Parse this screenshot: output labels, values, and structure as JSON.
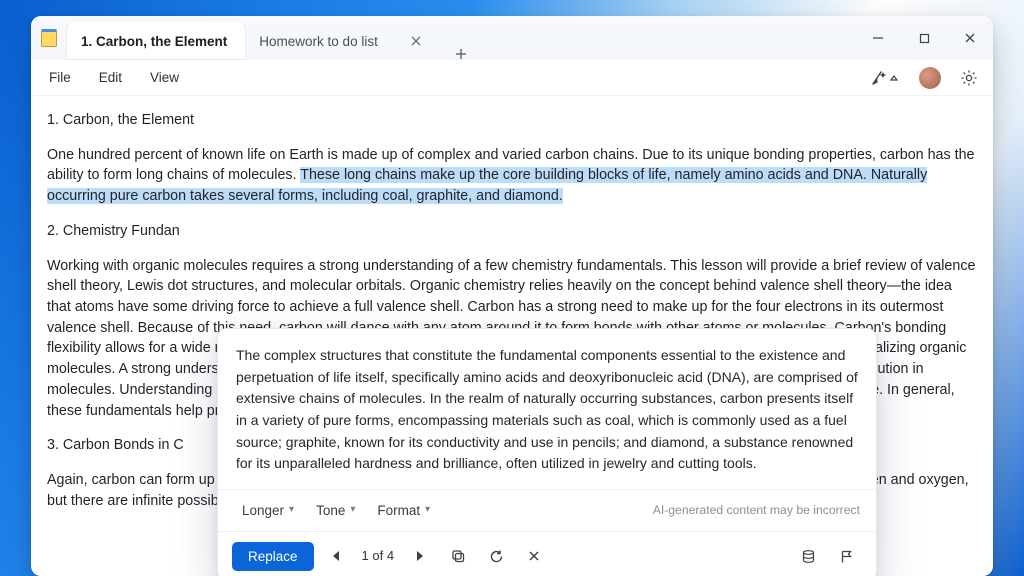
{
  "tabs": {
    "active": "1. Carbon, the Element",
    "inactive": "Homework to do list"
  },
  "menus": {
    "file": "File",
    "edit": "Edit",
    "view": "View"
  },
  "doc": {
    "h1": "1. Carbon, the Element",
    "p1a": "One hundred percent of known life on Earth is made up of complex and varied carbon chains. Due to its unique bonding properties, carbon has the ability to form long chains of molecules. ",
    "p1b_hl": "These long chains make up the core building blocks of life, namely amino acids and DNA. Naturally occurring pure carbon takes several forms, including coal, graphite, and diamond.",
    "h2": "2. Chemistry Fundan",
    "p2": "Working with organic molecules requires a strong understanding of a few chemistry fundamentals. This lesson will provide a brief review of valence shell theory, Lewis dot structures, and molecular orbitals. Organic chemistry relies heavily on the concept behind valence shell theory—the idea that atoms have some driving force to achieve a full valence shell. Carbon has a strong need to make up for the four electrons in its outermost valence shell. Because of this need, carbon will dance with any atom around it to form bonds with other atoms or molecules. Carbon's bonding flexibility allows for a wide range of molecular structures and formations. Lewis dot structures play a pivotal role in drawing and visualizing organic molecules. A strong understanding of resonance forms (including resonant structures) can help with understanding electronic distribution in molecules. Understanding molecular orbitals and orbital shells can help illuminate the eventual shape and geometry of the molecule. In general, these fundamentals help provide the promise a molecule can tell us its basic shape and characteristics.",
    "h3": "3. Carbon Bonds in C",
    "p3": "Again, carbon can form up to four bonds with other molecules. In organic chemistry, we mainly focus on carbon chains with hydrogen and oxygen, but there are infinite possible compounds. In the simplest form, carbon bonds with four hydrogen in single bonds. In other instances"
  },
  "popup": {
    "text": "The complex structures that constitute the fundamental components essential to the existence and perpetuation of life itself, specifically amino acids and deoxyribonucleic acid (DNA), are comprised of extensive chains of molecules. In the realm of naturally occurring substances, carbon presents itself in a variety of pure forms, encompassing materials such as coal, which is commonly used as a fuel source; graphite, known for its conductivity and use in pencils; and diamond, a substance renowned for its unparalleled hardness and brilliance, often utilized in jewelry and cutting tools.",
    "longer": "Longer",
    "tone": "Tone",
    "format": "Format",
    "ai_note": "AI-generated content may be incorrect",
    "replace": "Replace",
    "counter": "1 of 4"
  }
}
